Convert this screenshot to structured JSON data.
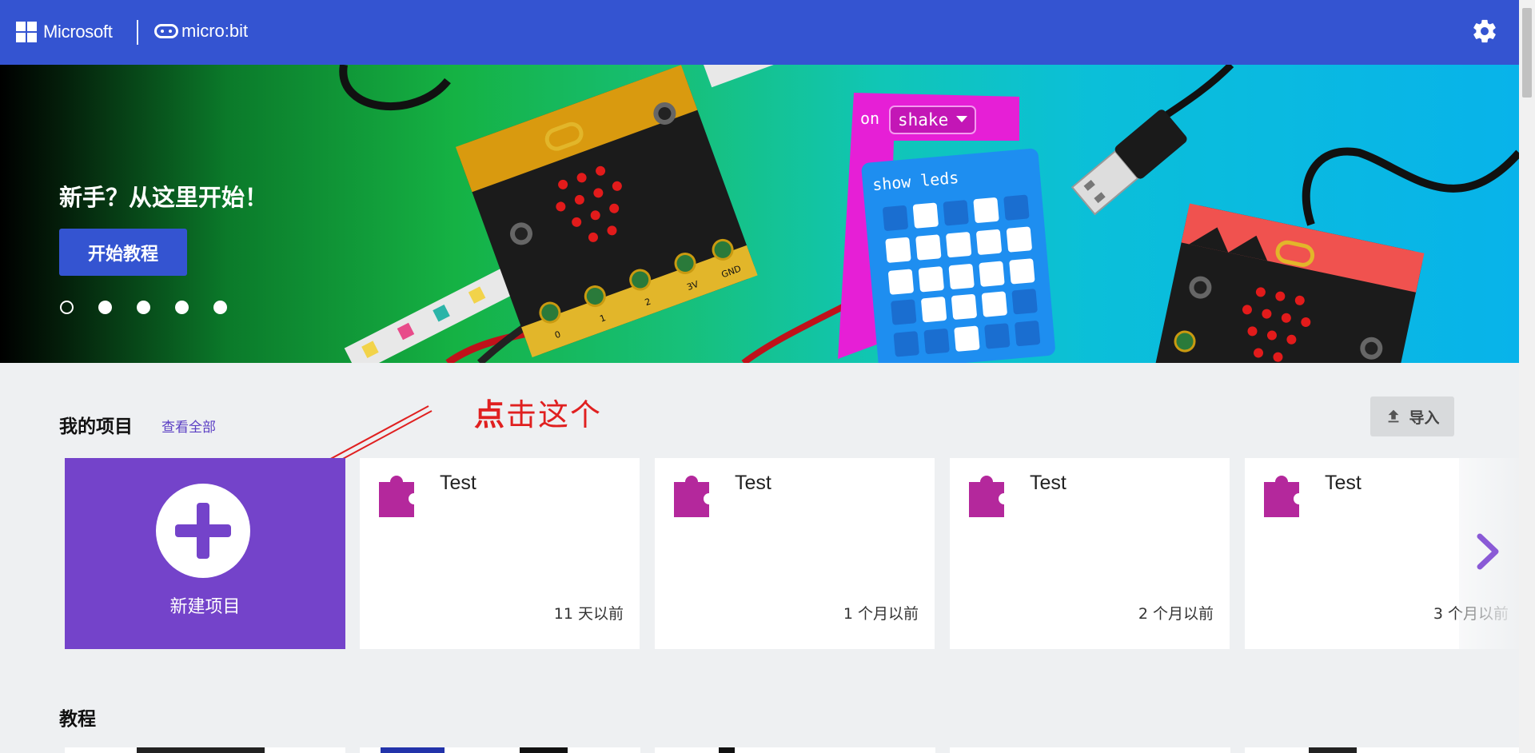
{
  "header": {
    "microsoft_label": "Microsoft",
    "microbit_label": "micro:bit",
    "settings_icon": "gear-icon"
  },
  "hero": {
    "title": "新手？从这里开始！",
    "start_button": "开始教程",
    "carousel_count": 5,
    "carousel_active": 0,
    "art_text": {
      "on_block": "on",
      "shake_block": "shake",
      "show_leds_block": "show leds",
      "pin_labels": [
        "0",
        "1",
        "2",
        "3V",
        "GND"
      ]
    }
  },
  "projects": {
    "title": "我的项目",
    "see_all": "查看全部",
    "annotation_bold": "点",
    "annotation_rest": "击这个",
    "import_label": "导入",
    "new_project_label": "新建项目",
    "items": [
      {
        "name": "Test",
        "time": "11 天以前"
      },
      {
        "name": "Test",
        "time": "1 个月以前"
      },
      {
        "name": "Test",
        "time": "2 个月以前"
      },
      {
        "name": "Test",
        "time": "3 个月以前"
      }
    ]
  },
  "tutorials": {
    "title": "教程"
  },
  "colors": {
    "header_blue": "#3454d1",
    "new_card_purple": "#7443ca",
    "puzzle_magenta": "#b4289c",
    "annotation_red": "#e02020"
  }
}
